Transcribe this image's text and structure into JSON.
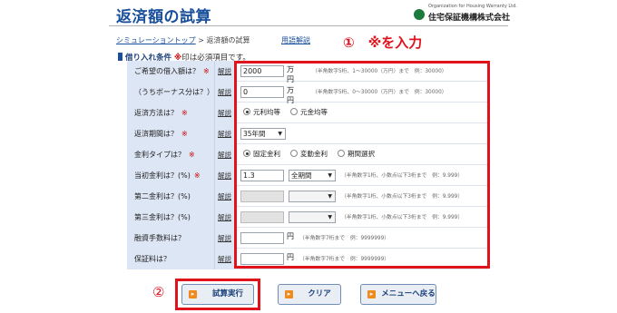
{
  "header": {
    "title": "返済額の試算",
    "logo_small": "Organization for Housing Warranty Ltd.",
    "logo_name": "住宅保証機構株式会社",
    "logo_icon": "green-circle-icon"
  },
  "breadcrumb": {
    "home": "シミュレーショントップ",
    "separator": ">",
    "current": "返済額の試算",
    "help_link": "用語解説"
  },
  "section": {
    "title": "借り入れ条件",
    "note_mark": "※",
    "note_text": "印は必須項目です。"
  },
  "help_label": "解説",
  "required_mark": "※",
  "rows": {
    "loan_amount": {
      "label": "ご希望の借入額は？",
      "value": "2000",
      "unit": "万円",
      "hint": "（半角数字5桁、1～30000（万円）まで　例：30000）"
    },
    "bonus": {
      "label": "（うちボーナス分は？）",
      "value": "0",
      "unit": "万円",
      "hint": "（半角数字5桁、0～30000（万円）まで　例：30000）"
    },
    "method": {
      "label": "返済方法は？",
      "option1": "元利均等",
      "option2": "元金均等"
    },
    "term": {
      "label": "返済期間は？",
      "value": "35年間"
    },
    "rate_type": {
      "label": "金利タイプは？",
      "option1": "固定金利",
      "option2": "変動金利",
      "option3": "期間選択"
    },
    "rate1": {
      "label": "当初金利は？(%)",
      "value": "1.3",
      "period": "全期間",
      "hint": "（半角数字1桁、小数点以下3桁まで　例：9.999）"
    },
    "rate2": {
      "label": "第二金利は？(%)",
      "value": "",
      "period": "",
      "hint": "（半角数字1桁、小数点以下3桁まで　例：9.999）"
    },
    "rate3": {
      "label": "第三金利は？(%)",
      "value": "",
      "period": "",
      "hint": "（半角数字1桁、小数点以下3桁まで　例：9.999）"
    },
    "fee": {
      "label": "融資手数料は？",
      "value": "",
      "unit": "円",
      "hint": "（半角数字7桁まで　例：9999999）"
    },
    "guarantee": {
      "label": "保証料は？",
      "value": "",
      "unit": "円",
      "hint": "（半角数字7桁まで　例：9999999）"
    }
  },
  "annotations": {
    "one": "①　※を入力",
    "two": "②"
  },
  "buttons": {
    "calc": "試算実行",
    "clear": "クリア",
    "menu": "メニューへ戻る"
  },
  "colors": {
    "accent": "#1a4f9c",
    "annotation_red": "#e0121c",
    "label_bg": "#dde6f4"
  }
}
